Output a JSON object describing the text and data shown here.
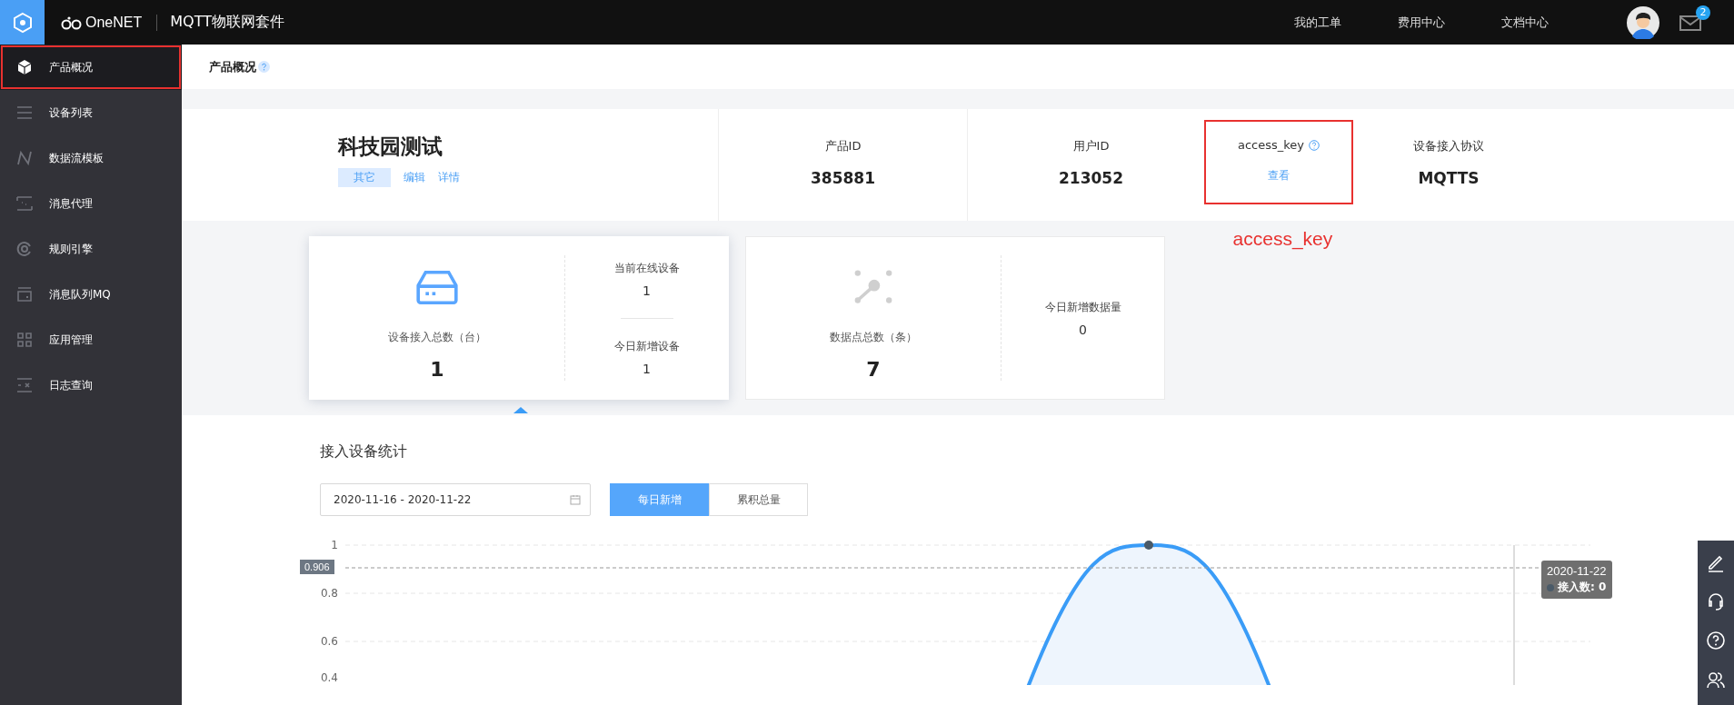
{
  "topbar": {
    "brand": "OneNET",
    "product": "MQTT物联网套件",
    "links": [
      "我的工单",
      "费用中心",
      "文档中心"
    ],
    "mail_badge": "2"
  },
  "sidebar": {
    "items": [
      {
        "label": "产品概况",
        "kind": "cube",
        "selected": true,
        "highlighted": true
      },
      {
        "label": "设备列表",
        "kind": "list",
        "selected": false,
        "highlighted": false
      },
      {
        "label": "数据流模板",
        "kind": "flow",
        "selected": false,
        "highlighted": false
      },
      {
        "label": "消息代理",
        "kind": "proxy",
        "selected": false,
        "highlighted": false
      },
      {
        "label": "规则引擎",
        "kind": "rule",
        "selected": false,
        "highlighted": false
      },
      {
        "label": "消息队列MQ",
        "kind": "queue",
        "selected": false,
        "highlighted": false
      },
      {
        "label": "应用管理",
        "kind": "apps",
        "selected": false,
        "highlighted": false
      },
      {
        "label": "日志查询",
        "kind": "log",
        "selected": false,
        "highlighted": false
      }
    ]
  },
  "breadcrumb": {
    "title": "产品概况"
  },
  "product": {
    "name": "科技园测试",
    "tag": "其它",
    "actions": [
      "编辑",
      "详情"
    ],
    "fields": [
      {
        "label": "产品ID",
        "value": "385881",
        "kind": "text",
        "highlighted": false
      },
      {
        "label": "用户ID",
        "value": "213052",
        "kind": "text",
        "highlighted": false
      },
      {
        "label": "access_key",
        "value": "查看",
        "kind": "link",
        "highlighted": true,
        "annotation": "access_key"
      },
      {
        "label": "设备接入协议",
        "value": "MQTTS",
        "kind": "text",
        "highlighted": false
      }
    ]
  },
  "stats": [
    {
      "kind": "device",
      "selected": true,
      "main_label": "设备接入总数（台）",
      "main_value": "1",
      "side": [
        {
          "label": "当前在线设备",
          "value": "1"
        },
        {
          "label": "今日新增设备",
          "value": "1"
        }
      ]
    },
    {
      "kind": "datapoint",
      "selected": false,
      "main_label": "数据点总数（条）",
      "main_value": "7",
      "side": [
        {
          "label": "今日新增数据量",
          "value": "0"
        }
      ]
    }
  ],
  "chart_section": {
    "title": "接入设备统计",
    "date_range": "2020-11-16 - 2020-11-22",
    "modes": [
      {
        "label": "每日新增",
        "selected": true
      },
      {
        "label": "累积总量",
        "selected": false
      }
    ],
    "y_labels": [
      "1",
      "0.8",
      "0.6",
      "0.4"
    ],
    "crosshair_value": "0.906",
    "tooltip": {
      "date": "2020-11-22",
      "text": "接入数: 0"
    }
  }
}
